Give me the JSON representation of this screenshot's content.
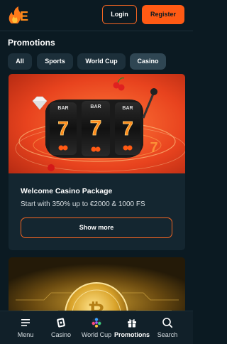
{
  "header": {
    "logo_text": "E",
    "login_label": "Login",
    "register_label": "Register"
  },
  "page": {
    "title": "Promotions"
  },
  "tabs": [
    {
      "label": "All",
      "active": false
    },
    {
      "label": "Sports",
      "active": false
    },
    {
      "label": "World Cup",
      "active": false
    },
    {
      "label": "Casino",
      "active": true
    }
  ],
  "promo": {
    "title": "Welcome Casino Package",
    "description": "Start with 350% up to €2000 & 1000 FS",
    "button_label": "Show more",
    "slot_reel_symbols": [
      "BAR",
      "7",
      "7",
      "7"
    ]
  },
  "bottom_nav": [
    {
      "label": "Menu",
      "icon": "menu-icon",
      "active": false
    },
    {
      "label": "Casino",
      "icon": "casino-icon",
      "active": false
    },
    {
      "label": "World Cup",
      "icon": "world-cup-ball-icon",
      "active": false
    },
    {
      "label": "Promotions",
      "icon": "gift-icon",
      "active": true
    },
    {
      "label": "Search",
      "icon": "search-icon",
      "active": false
    }
  ],
  "colors": {
    "background": "#0b1a22",
    "accent": "#ff5a14",
    "card": "#142630",
    "tab": "#1c2f3a",
    "tab_active": "#2f4653"
  }
}
